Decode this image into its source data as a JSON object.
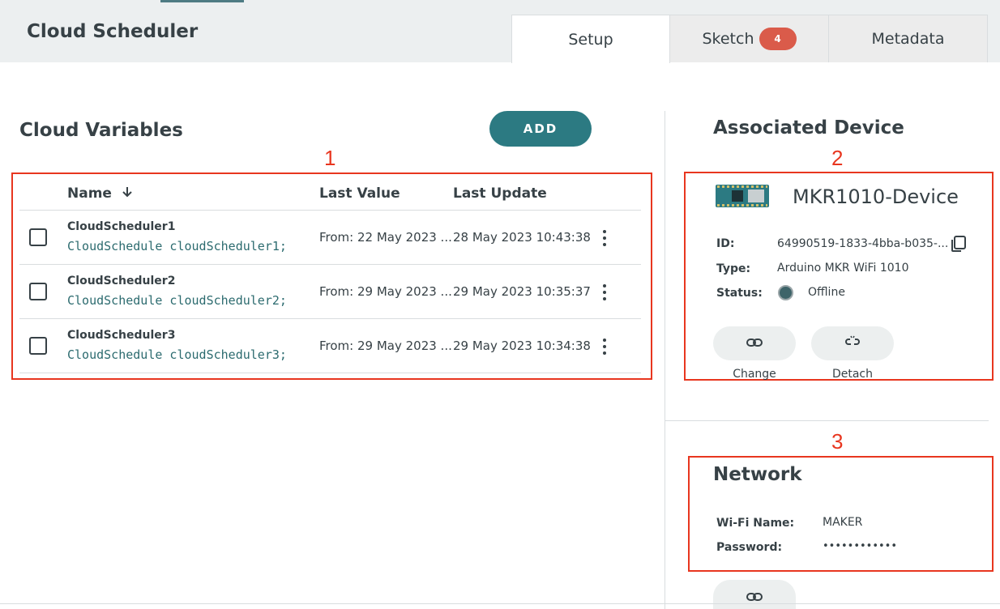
{
  "header": {
    "title": "Cloud Scheduler",
    "tabs": [
      {
        "label": "Setup",
        "active": true
      },
      {
        "label": "Sketch",
        "badge": "4"
      },
      {
        "label": "Metadata"
      }
    ]
  },
  "variables": {
    "title": "Cloud Variables",
    "add_label": "ADD",
    "columns": {
      "name": "Name",
      "last_value": "Last Value",
      "last_update": "Last Update"
    },
    "rows": [
      {
        "name": "CloudScheduler1",
        "declaration": "CloudSchedule cloudScheduler1;",
        "last_value": "From: 22 May 2023 ...",
        "last_update": "28 May 2023 10:43:38"
      },
      {
        "name": "CloudScheduler2",
        "declaration": "CloudSchedule cloudScheduler2;",
        "last_value": "From: 29 May 2023 ...",
        "last_update": "29 May 2023 10:35:37"
      },
      {
        "name": "CloudScheduler3",
        "declaration": "CloudSchedule cloudScheduler3;",
        "last_value": "From: 29 May 2023 ...",
        "last_update": "29 May 2023 10:34:38"
      }
    ]
  },
  "device": {
    "section_title": "Associated Device",
    "name": "MKR1010-Device",
    "id_label": "ID:",
    "id_value": "64990519-1833-4bba-b035-...",
    "type_label": "Type:",
    "type_value": "Arduino MKR WiFi 1010",
    "status_label": "Status:",
    "status_value": "Offline",
    "change_label": "Change",
    "detach_label": "Detach"
  },
  "network": {
    "title": "Network",
    "wifi_label": "Wi-Fi Name:",
    "wifi_value": "MAKER",
    "password_label": "Password:",
    "password_value": "••••••••••••"
  },
  "callouts": [
    "1",
    "2",
    "3"
  ],
  "colors": {
    "accent": "#2c7a82",
    "callout": "#e8361f",
    "badge": "#da5b4a"
  }
}
